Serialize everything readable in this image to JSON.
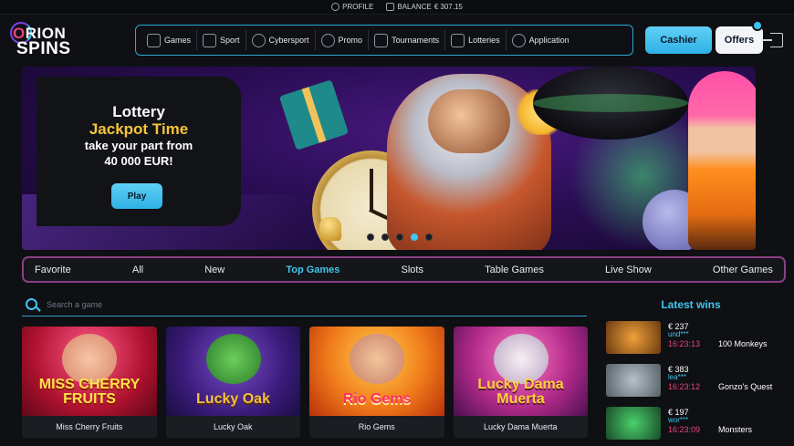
{
  "topbar": {
    "profile_label": "PROFILE",
    "balance_label": "BALANCE",
    "balance_value": "€ 307.15"
  },
  "brand": {
    "line1_prefix": "O",
    "line1_rest": "RION",
    "line2": "SPINS"
  },
  "nav": {
    "items": [
      {
        "label": "Games",
        "icon": "games-icon"
      },
      {
        "label": "Sport",
        "icon": "trophy-icon"
      },
      {
        "label": "Cybersport",
        "icon": "controller-icon"
      },
      {
        "label": "Promo",
        "icon": "horseshoe-icon"
      },
      {
        "label": "Tournaments",
        "icon": "tournaments-icon"
      },
      {
        "label": "Lotteries",
        "icon": "diamond-icon"
      },
      {
        "label": "Application",
        "icon": "download-icon"
      }
    ],
    "cashier_label": "Cashier",
    "offers_label": "Offers"
  },
  "banner": {
    "title": "Lottery",
    "subtitle": "Jackpot Time",
    "text_line1": "take your part from",
    "text_line2": "40 000 EUR!",
    "button_label": "Play",
    "slides": 5,
    "active_slide": 4
  },
  "categories": {
    "items": [
      "Favorite",
      "All",
      "New",
      "Top Games",
      "Slots",
      "Table Games",
      "Live Show",
      "Other Games"
    ],
    "active": "Top Games"
  },
  "search": {
    "placeholder": "Search a game"
  },
  "games": [
    {
      "name": "Miss Cherry Fruits",
      "logo": "MISS CHERRY FRUITS"
    },
    {
      "name": "Lucky Oak",
      "logo": "Lucky Oak"
    },
    {
      "name": "Rio Gems",
      "logo": "Rio Gems"
    },
    {
      "name": "Lucky Dama Muerta",
      "logo": "Lucky Dama Muerta"
    }
  ],
  "latest_wins": {
    "title": "Latest wins",
    "items": [
      {
        "amount": "€ 237",
        "user": "und***",
        "time": "16:23:13",
        "game": "100 Monkeys"
      },
      {
        "amount": "€ 383",
        "user": "lea***",
        "time": "16:23:12",
        "game": "Gonzo's Quest"
      },
      {
        "amount": "€ 197",
        "user": "wor***",
        "time": "16:23:09",
        "game": "Monsters"
      }
    ]
  },
  "colors": {
    "accent": "#3fc6f0",
    "brand_pink": "#e8447d",
    "gold": "#f5c43a",
    "tab_border": "#8a3f86"
  }
}
